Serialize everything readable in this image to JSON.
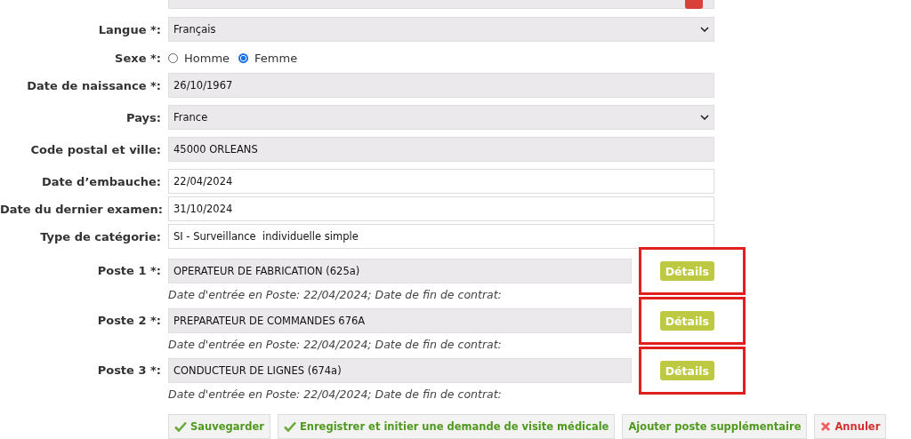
{
  "fields": [
    {
      "kind": "cut"
    },
    {
      "kind": "select",
      "label": "Langue *:",
      "value": "Français"
    },
    {
      "kind": "radio",
      "label": "Sexe *:",
      "options": [
        {
          "label": "Homme",
          "selected": false
        },
        {
          "label": "Femme",
          "selected": true
        }
      ]
    },
    {
      "kind": "readonly",
      "label": "Date de naissance *:",
      "value": "26/10/1967"
    },
    {
      "kind": "select",
      "label": "Pays:",
      "value": "France"
    },
    {
      "kind": "readonly",
      "label": "Code postal et ville:",
      "value": "45000 ORLEANS"
    },
    {
      "kind": "input",
      "label": "Date d’embauche:",
      "value": "22/04/2024"
    },
    {
      "kind": "input",
      "label": "Date du dernier examen:",
      "value": "31/10/2024"
    },
    {
      "kind": "input",
      "label": "Type de catégorie:",
      "value": "SI - Surveillance  individuelle simple"
    }
  ],
  "postes": [
    {
      "label": "Poste 1 *:",
      "value": "OPERATEUR DE FABRICATION (625a)",
      "button": "Détails",
      "note": "Date d'entrée en Poste: 22/04/2024; Date de fin de contrat:",
      "highlighted": true
    },
    {
      "label": "Poste 2 *:",
      "value": "PREPARATEUR DE COMMANDES 676A",
      "button": "Détails",
      "note": "Date d'entrée en Poste: 22/04/2024; Date de fin de contrat:",
      "highlighted": true
    },
    {
      "label": "Poste 3 *:",
      "value": "CONDUCTEUR DE LIGNES (674a)",
      "button": "Détails",
      "note": "Date d'entrée en Poste: 22/04/2024; Date de fin de contrat:",
      "highlighted": true
    }
  ],
  "actions": [
    {
      "kind": "check",
      "label": "Sauvegarder"
    },
    {
      "kind": "check",
      "label": "Enregistrer et initier une demande de visite médicale"
    },
    {
      "kind": "plain",
      "label": "Ajouter poste supplémentaire"
    },
    {
      "kind": "cancel",
      "label": "Annuler"
    }
  ]
}
